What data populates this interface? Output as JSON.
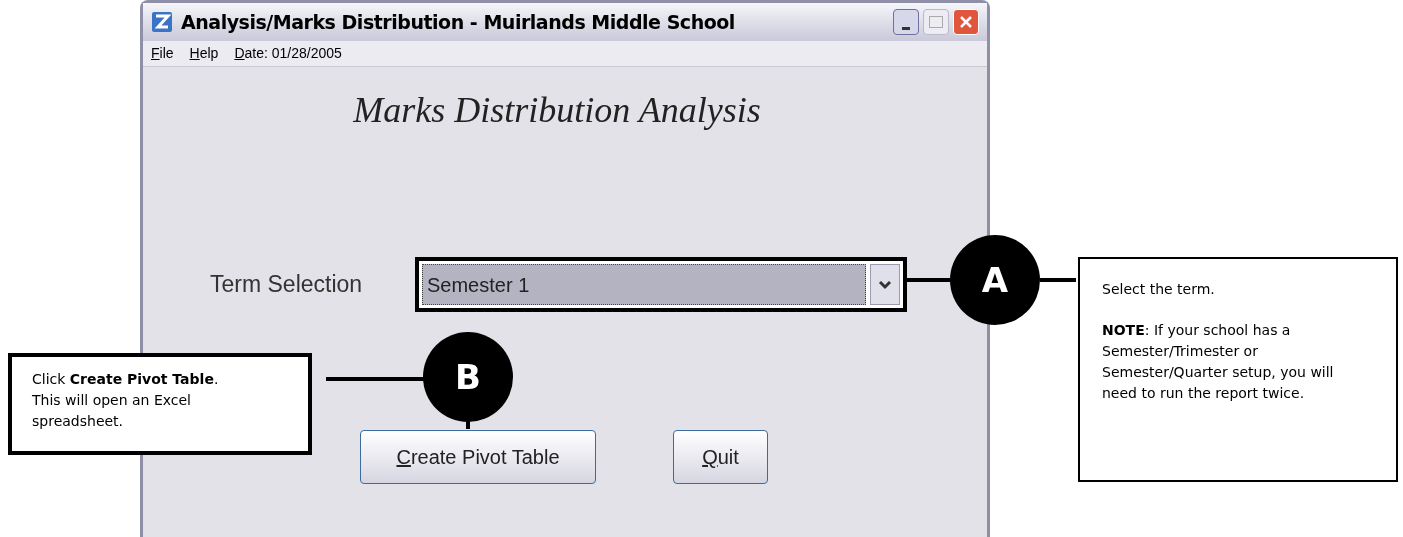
{
  "window": {
    "title": "Analysis/Marks Distribution - Muirlands Middle School"
  },
  "menu": [
    {
      "label": "File"
    },
    {
      "label": "Help"
    }
  ],
  "date": "Date: 01/28/2005",
  "heading": "Marks Distribution Analysis",
  "term": {
    "label": "Term Selection",
    "value": "Semester 1"
  },
  "buttons": [
    {
      "label": "Create Pivot Table"
    },
    {
      "label": "Quit"
    }
  ],
  "callouts": [
    {
      "marker": "A",
      "paragraphs": [
        "Select the term.",
        "**NOTE**: If your school has a Semester/Trimester or Semester/Quarter setup, you will need to run the report twice."
      ]
    },
    {
      "marker": "B",
      "paragraphs": [
        "Click **Create Pivot Table**. This will open an Excel spreadsheet."
      ]
    }
  ]
}
